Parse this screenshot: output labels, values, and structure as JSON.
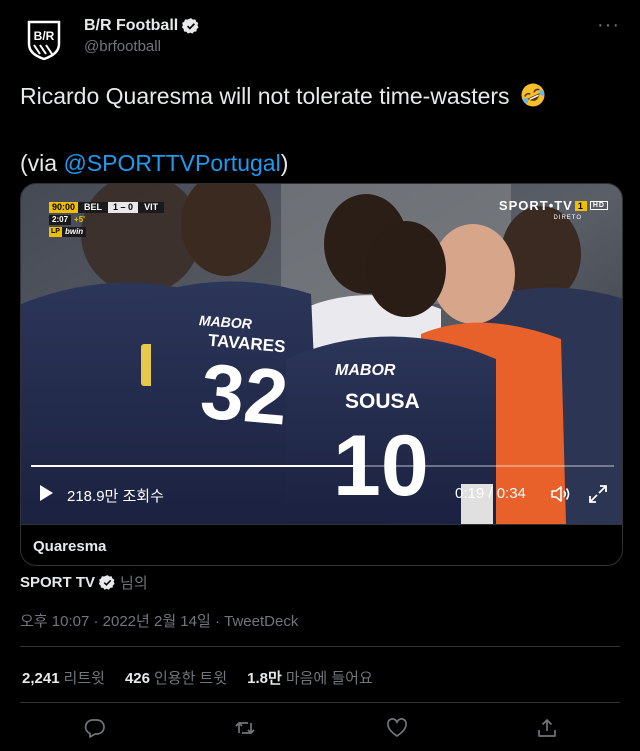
{
  "tweet": {
    "author": {
      "display_name": "B/R Football",
      "handle": "@brfootball",
      "avatar_icon": "br-shield-logo"
    },
    "text_line1": "Ricardo Quaresma will not tolerate time-wasters",
    "text_line2_prefix": "(via ",
    "text_line2_mention": "@SPORTTVPortugal",
    "text_line2_suffix": ")",
    "more_label": "···"
  },
  "video": {
    "scorebug": {
      "time": "90:00",
      "home": "BEL",
      "score": "1 – 0",
      "away": "VIT",
      "added_time_clock": "2:07",
      "added_time": "+5'",
      "lp": "LP",
      "sponsor": "bwin"
    },
    "channel": {
      "name": "SPORT•TV",
      "number": "1",
      "hd": "HD",
      "live": "DIRETO"
    },
    "players": {
      "left_name": "TAVARES",
      "left_number": "32",
      "center_name": "SOUSA",
      "center_number": "10",
      "shirt_sponsor": "MABOR"
    },
    "progress_fraction": 0.56,
    "views": "218.9만 조회수",
    "timecode": "0:19 / 0:34",
    "caption": "Quaresma"
  },
  "source": {
    "name": "SPORT TV",
    "suffix": "님의"
  },
  "meta": {
    "time": "오후 10:07",
    "date": "2022년 2월 14일",
    "client": "TweetDeck",
    "sep": " · "
  },
  "stats": {
    "retweets_count": "2,241",
    "retweets_label": "리트윗",
    "quotes_count": "426",
    "quotes_label": "인용한 트윗",
    "likes_count": "1.8만",
    "likes_label": "마음에 들어요"
  },
  "colors": {
    "background": "#000000",
    "text": "#e7e9ea",
    "muted": "#71767b",
    "link": "#1d9bf0",
    "border": "#2f3336"
  }
}
